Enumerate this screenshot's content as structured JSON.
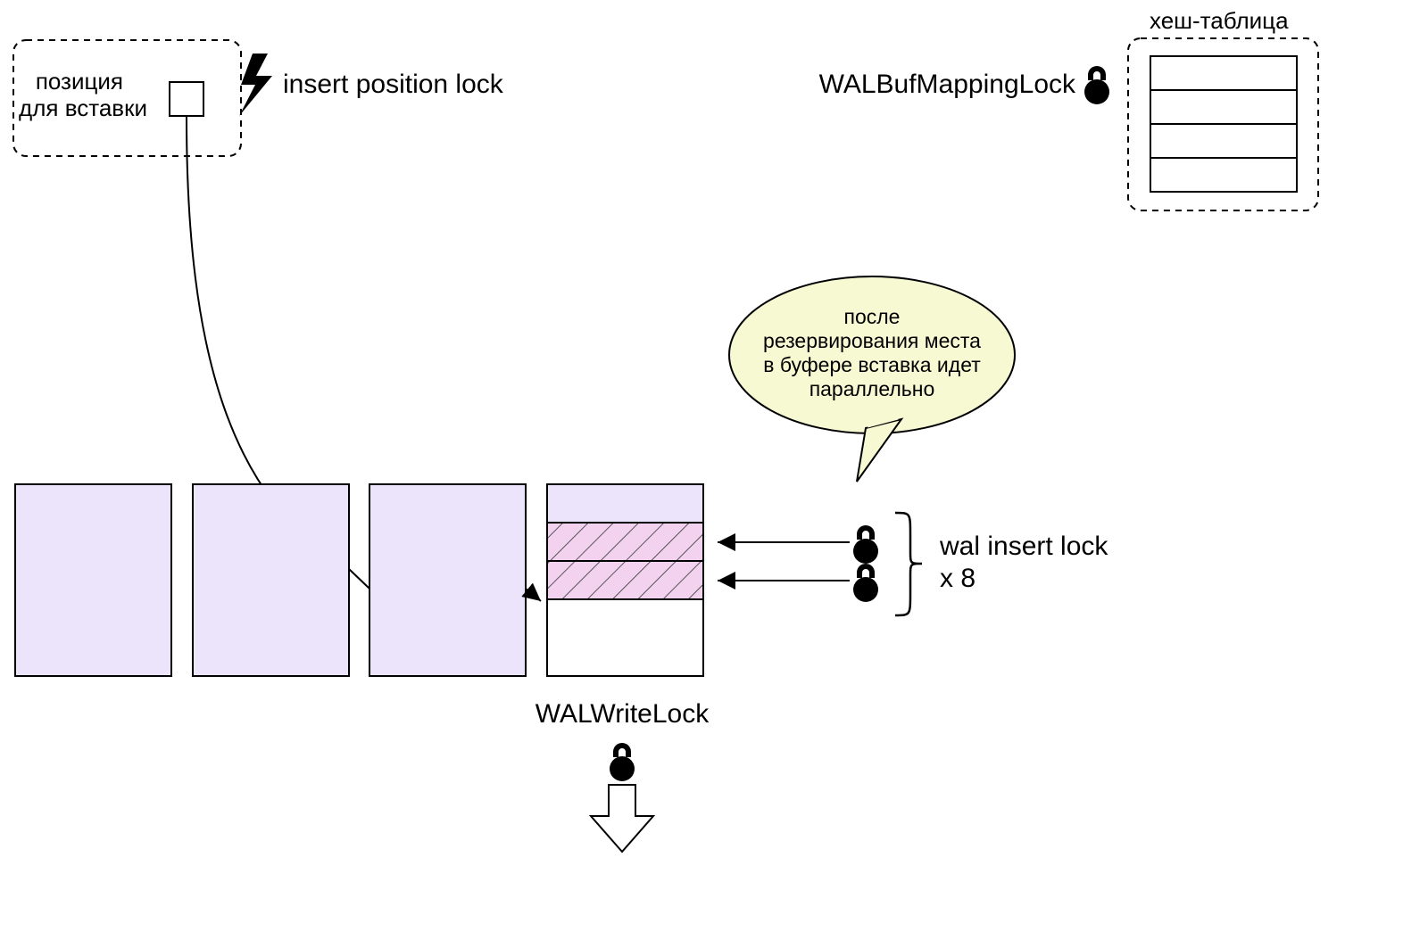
{
  "insert_position_box_label_line1": "позиция",
  "insert_position_box_label_line2": "для вставки",
  "insert_position_lock_label": "insert position lock",
  "walbuf_label": "WALBufMappingLock",
  "hash_table_label": "хеш-таблица",
  "callout_line1": "после",
  "callout_line2": "резервирования места",
  "callout_line3": "в буфере вставка идет",
  "callout_line4": "параллельно",
  "wal_insert_lock_line1": "wal insert lock",
  "wal_insert_lock_line2": "x 8",
  "walwrite_label": "WALWriteLock",
  "colors": {
    "buffer_fill": "#ece4fa",
    "stripe_fill": "#f3d2ef",
    "balloon_fill": "#f7f9d3"
  }
}
